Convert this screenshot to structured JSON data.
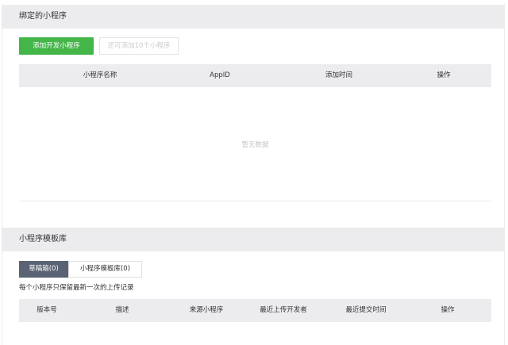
{
  "bound_section": {
    "title": "绑定的小程序",
    "add_button": "添加开发小程序",
    "remaining_button": "还可添加10个小程序",
    "columns": [
      "小程序名称",
      "AppID",
      "添加时间",
      "操作"
    ],
    "empty_text": "暂无数据"
  },
  "template_section": {
    "title": "小程序模板库",
    "tabs": [
      "草稿箱(0)",
      "小程序模板库(0)"
    ],
    "note": "每个小程序只保留最新一次的上传记录",
    "columns": [
      "版本号",
      "描述",
      "来源小程序",
      "最近上传开发者",
      "最近提交时间",
      "操作"
    ]
  },
  "colors": {
    "accent_green": "#44b549",
    "active_tab": "#596373",
    "header_bg": "#ececef"
  }
}
